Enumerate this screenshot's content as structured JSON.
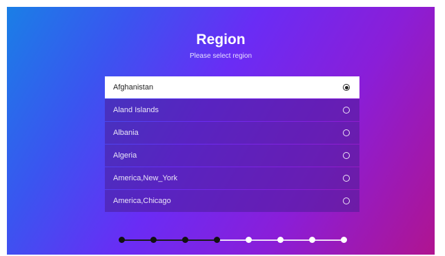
{
  "header": {
    "title": "Region",
    "subtitle": "Please select region"
  },
  "regions": [
    {
      "label": "Afghanistan",
      "selected": true
    },
    {
      "label": "Aland Islands",
      "selected": false
    },
    {
      "label": "Albania",
      "selected": false
    },
    {
      "label": "Algeria",
      "selected": false
    },
    {
      "label": "America,New_York",
      "selected": false
    },
    {
      "label": "America,Chicago",
      "selected": false
    }
  ],
  "stepper": {
    "total_steps": 8,
    "completed_steps": 4
  },
  "colors": {
    "gradient_start": "#1a7fe6",
    "gradient_mid": "#6a2cf5",
    "gradient_end": "#b01490",
    "selected_row": "#ffffff",
    "step_done": "#111111",
    "step_todo": "#ffffff"
  }
}
